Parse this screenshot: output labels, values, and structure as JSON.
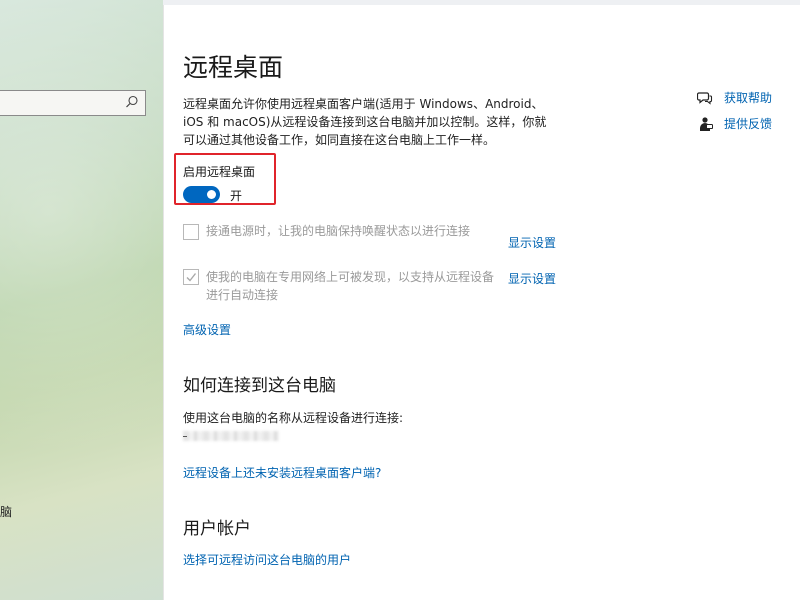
{
  "page": {
    "title": "远程桌面",
    "description": "远程桌面允许你使用远程桌面客户端(适用于 Windows、Android、iOS 和 macOS)从远程设备连接到这台电脑并加以控制。这样，你就可以通过其他设备工作，如同直接在这台电脑上工作一样。"
  },
  "remote_desktop": {
    "label": "启用远程桌面",
    "state": "开",
    "enabled": true
  },
  "options": [
    {
      "label": "接通电源时，让我的电脑保持唤醒状态以进行连接",
      "checked": false,
      "link": "显示设置"
    },
    {
      "label": "使我的电脑在专用网络上可被发现，以支持从远程设备进行自动连接",
      "checked": true,
      "link": "显示设置"
    }
  ],
  "advanced_settings": "高级设置",
  "how_to_connect": {
    "title": "如何连接到这台电脑",
    "text": "使用这台电脑的名称从远程设备进行连接:",
    "link": "远程设备上还未安装远程桌面客户端?"
  },
  "user_accounts": {
    "title": "用户帐户",
    "link": "选择可远程访问这台电脑的用户"
  },
  "help": {
    "get_help": "获取帮助",
    "feedback": "提供反馈"
  },
  "sidebar": {
    "fragment": "脑"
  },
  "colors": {
    "accent": "#0067c0",
    "link": "#0063b1",
    "highlight": "#e0242b"
  }
}
